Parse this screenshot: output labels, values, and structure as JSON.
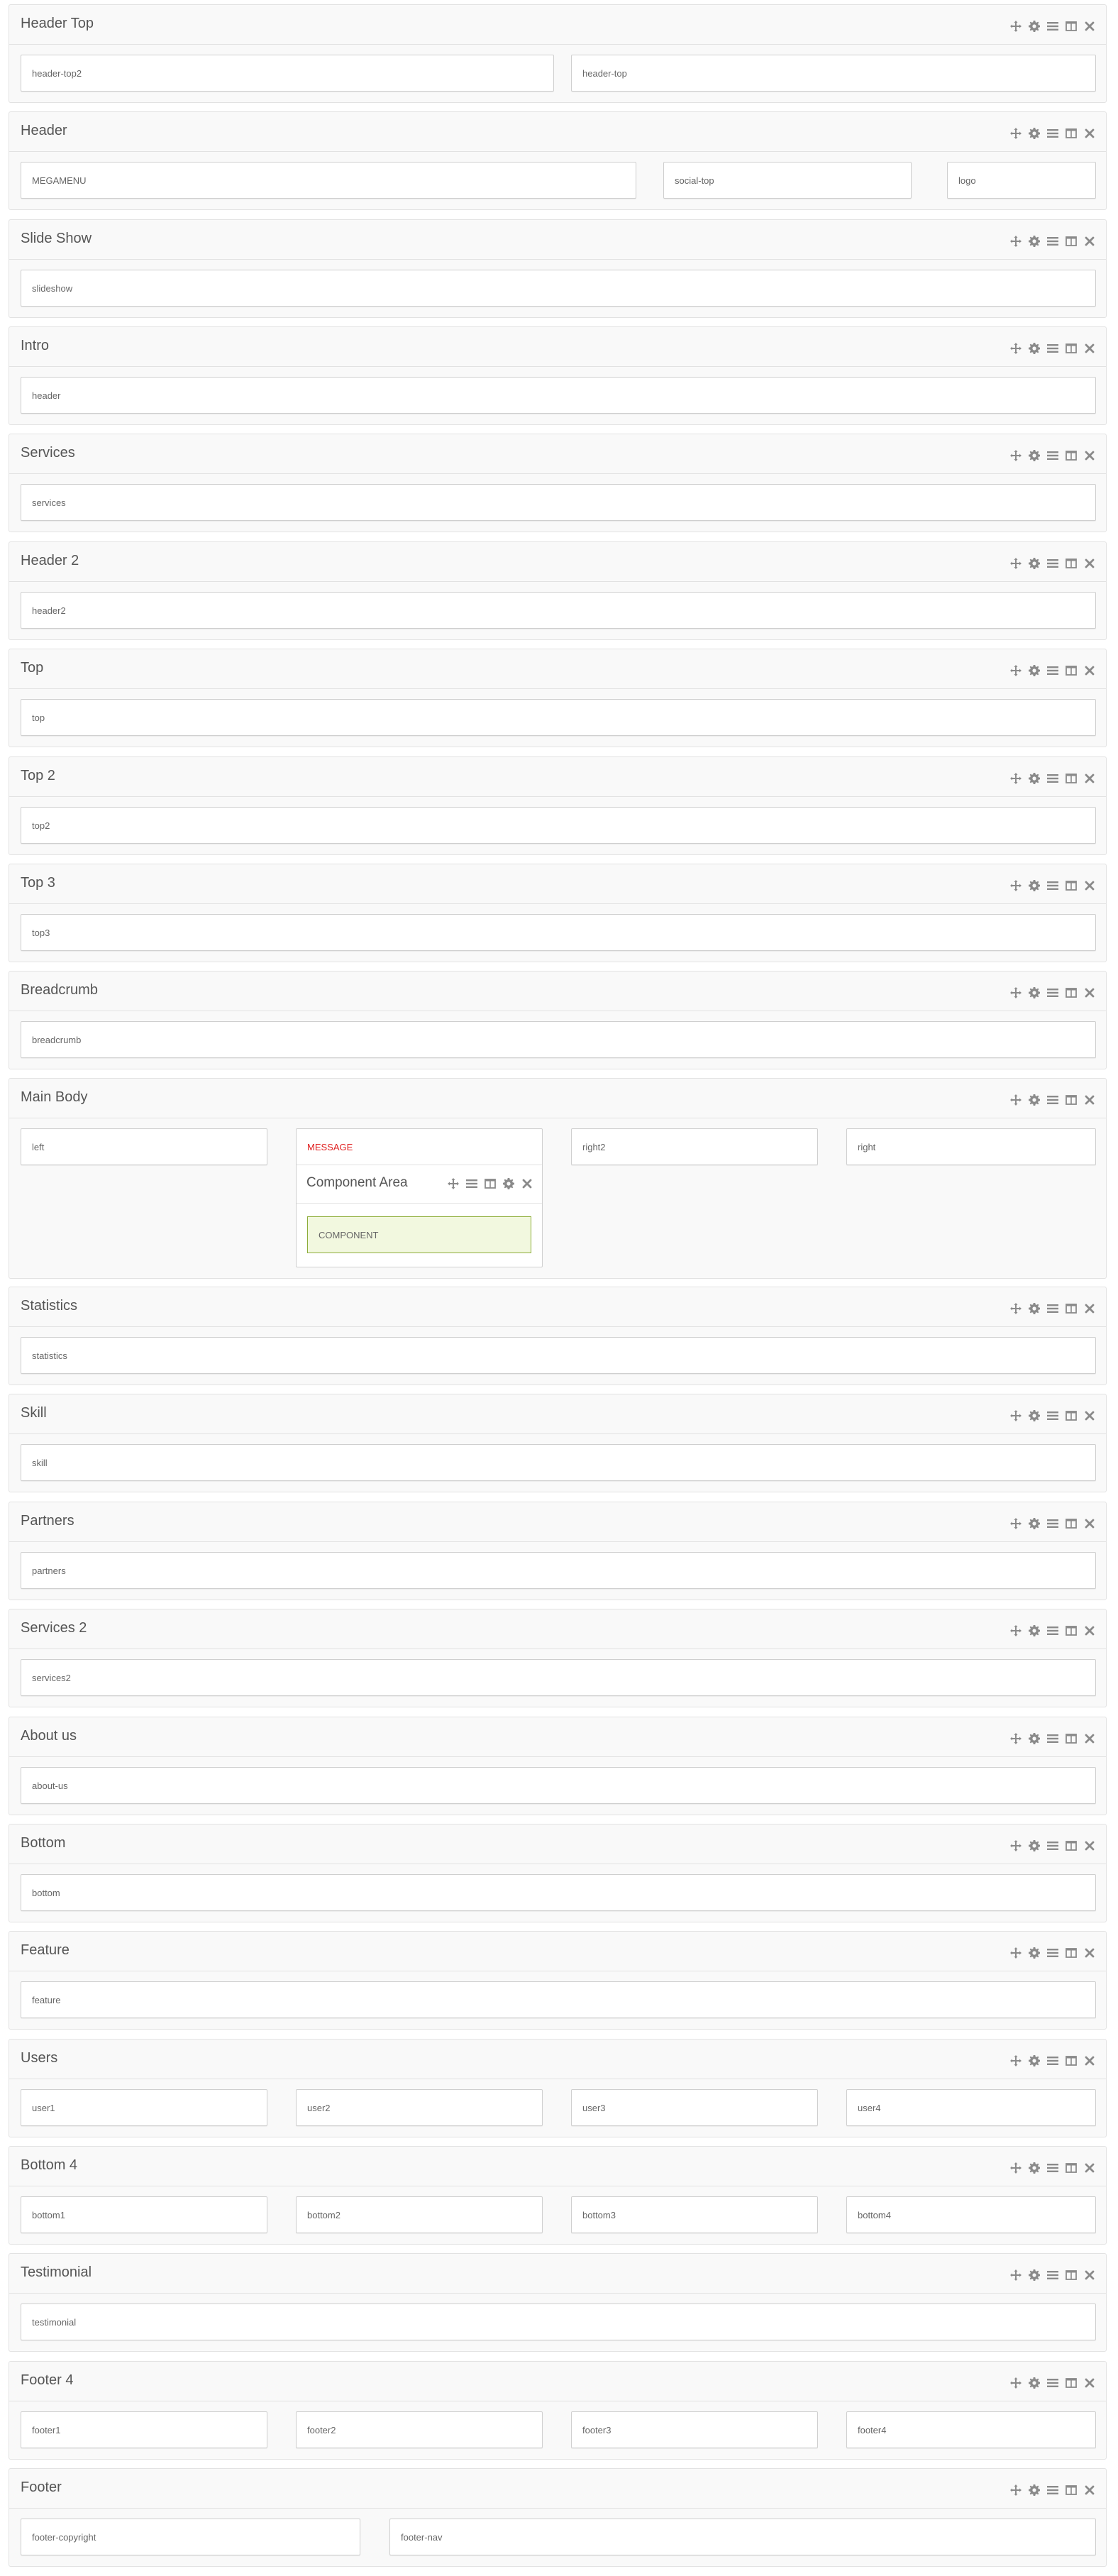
{
  "colors": {
    "icon": "#8a8a8a",
    "message": "#e02020",
    "component_bg": "#f2f8df",
    "component_border": "#8dad3a",
    "section_bg": "#f9f9f9",
    "border": "#e2e2e2"
  },
  "icons": {
    "section_tools": [
      "move-icon",
      "gear-icon",
      "menu-icon",
      "columns-icon",
      "close-icon"
    ],
    "component_tools": [
      "move-icon",
      "menu-icon",
      "columns-icon",
      "gear-icon",
      "close-icon"
    ]
  },
  "sections": [
    {
      "title": "Header Top",
      "positions": [
        "header-top2",
        "header-top"
      ]
    },
    {
      "title": "Header",
      "positions": [
        "MEGAMENU",
        "social-top",
        "logo"
      ]
    },
    {
      "title": "Slide Show",
      "positions": [
        "slideshow"
      ]
    },
    {
      "title": "Intro",
      "positions": [
        "header"
      ]
    },
    {
      "title": "Services",
      "positions": [
        "services"
      ]
    },
    {
      "title": "Header 2",
      "positions": [
        "header2"
      ]
    },
    {
      "title": "Top",
      "positions": [
        "top"
      ]
    },
    {
      "title": "Top 2",
      "positions": [
        "top2"
      ]
    },
    {
      "title": "Top 3",
      "positions": [
        "top3"
      ]
    },
    {
      "title": "Breadcrumb",
      "positions": [
        "breadcrumb"
      ]
    },
    {
      "title": "Main Body",
      "positions": [
        "left",
        "",
        "right2",
        "right"
      ],
      "component": {
        "message": "MESSAGE",
        "title": "Component Area",
        "label": "COMPONENT"
      }
    },
    {
      "title": "Statistics",
      "positions": [
        "statistics"
      ]
    },
    {
      "title": "Skill",
      "positions": [
        "skill"
      ]
    },
    {
      "title": "Partners",
      "positions": [
        "partners"
      ]
    },
    {
      "title": "Services 2",
      "positions": [
        "services2"
      ]
    },
    {
      "title": "About us",
      "positions": [
        "about-us"
      ]
    },
    {
      "title": "Bottom",
      "positions": [
        "bottom"
      ]
    },
    {
      "title": "Feature",
      "positions": [
        "feature"
      ]
    },
    {
      "title": "Users",
      "positions": [
        "user1",
        "user2",
        "user3",
        "user4"
      ]
    },
    {
      "title": "Bottom 4",
      "positions": [
        "bottom1",
        "bottom2",
        "bottom3",
        "bottom4"
      ]
    },
    {
      "title": "Testimonial",
      "positions": [
        "testimonial"
      ]
    },
    {
      "title": "Footer 4",
      "positions": [
        "footer1",
        "footer2",
        "footer3",
        "footer4"
      ]
    },
    {
      "title": "Footer",
      "positions": [
        "footer-copyright",
        "footer-nav"
      ]
    }
  ]
}
